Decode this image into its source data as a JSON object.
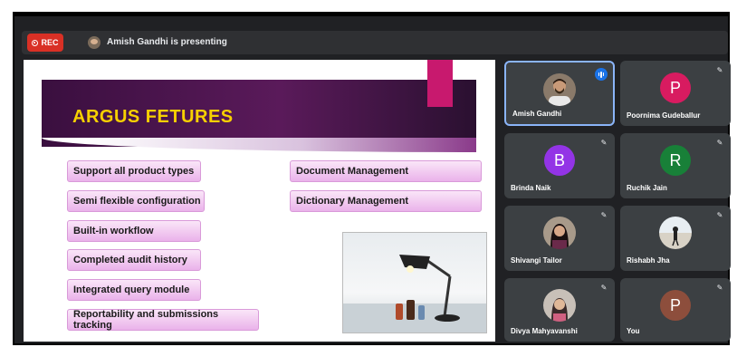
{
  "recording": {
    "label": "REC"
  },
  "presenter": {
    "text": "Amish Gandhi is presenting"
  },
  "slide": {
    "title": "ARGUS FETURES",
    "left_features": [
      "Support all product types",
      "Semi flexible configuration",
      "Built-in workflow",
      "Completed audit history",
      "Integrated query module",
      "Reportability and submissions tracking"
    ],
    "right_features": [
      "Document Management",
      "Dictionary Management"
    ]
  },
  "participants": [
    {
      "name": "Amish Gandhi",
      "letter": "",
      "avatar_color": "",
      "type": "photo-man",
      "muted": false,
      "speaking": true,
      "active": true
    },
    {
      "name": "Poornima Gudeballur",
      "letter": "P",
      "avatar_color": "#d81b60",
      "type": "letter",
      "muted": true,
      "speaking": false,
      "active": false
    },
    {
      "name": "Brinda Naik",
      "letter": "B",
      "avatar_color": "#9334e6",
      "type": "letter",
      "muted": true,
      "speaking": false,
      "active": false
    },
    {
      "name": "Ruchik Jain",
      "letter": "R",
      "avatar_color": "#188038",
      "type": "letter",
      "muted": true,
      "speaking": false,
      "active": false
    },
    {
      "name": "Shivangi Tailor",
      "letter": "",
      "avatar_color": "",
      "type": "photo-woman",
      "muted": true,
      "speaking": false,
      "active": false
    },
    {
      "name": "Rishabh Jha",
      "letter": "",
      "avatar_color": "",
      "type": "photo-beach",
      "muted": true,
      "speaking": false,
      "active": false
    },
    {
      "name": "Divya Mahyavanshi",
      "letter": "",
      "avatar_color": "",
      "type": "photo-woman2",
      "muted": true,
      "speaking": false,
      "active": false
    },
    {
      "name": "You",
      "letter": "P",
      "avatar_color": "#8d4e3c",
      "type": "letter",
      "muted": true,
      "speaking": false,
      "active": false
    }
  ],
  "colors": {
    "meet_bg": "#202124",
    "tile_bg": "#3c4043",
    "rec_red": "#d93025",
    "title_yellow": "#f7d000",
    "active_border": "#8ab4f8"
  },
  "icons": {
    "rec": "record-icon",
    "mute": "mic-off-icon",
    "speaking": "audio-level-icon"
  }
}
